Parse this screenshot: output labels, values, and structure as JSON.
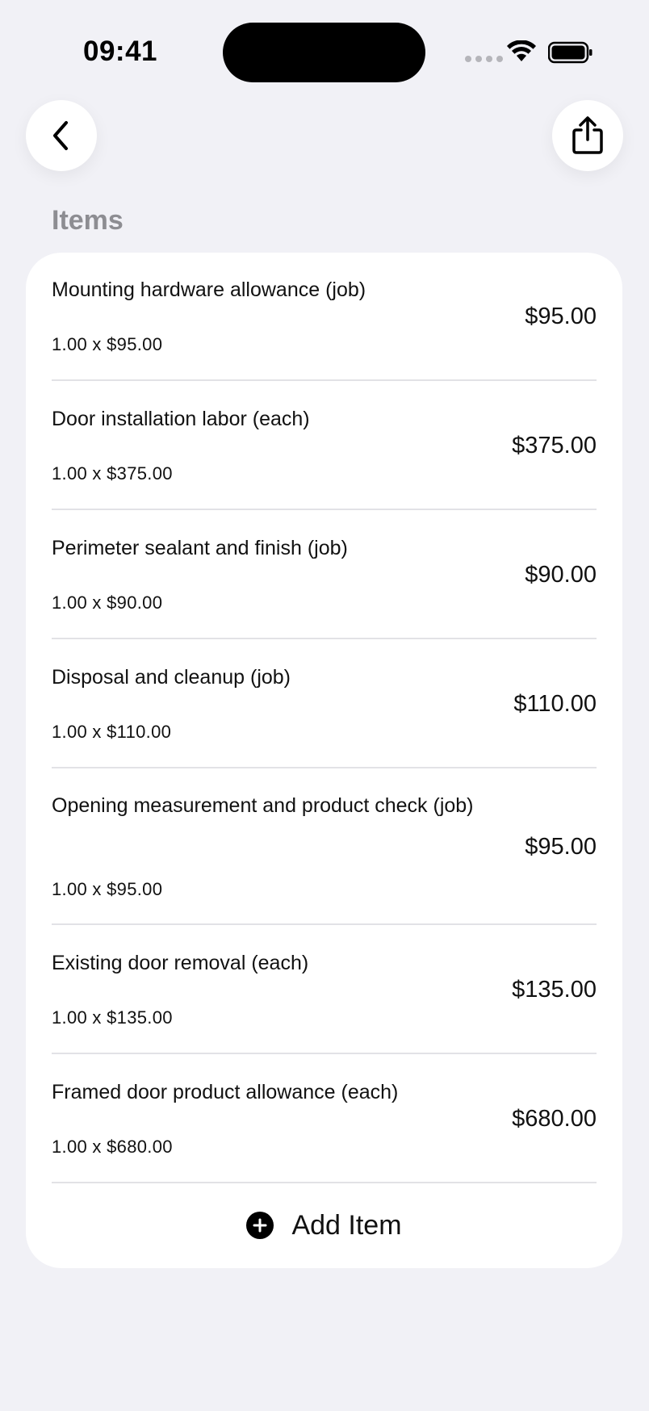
{
  "status_bar": {
    "time": "09:41"
  },
  "nav": {
    "back_icon": "chevron-left-icon",
    "share_icon": "share-icon"
  },
  "section": {
    "title": "Items"
  },
  "items": [
    {
      "name": "Mounting hardware allowance (job)",
      "qty": "1.00 x $95.00",
      "amount": "$95.00"
    },
    {
      "name": "Door installation labor (each)",
      "qty": "1.00 x $375.00",
      "amount": "$375.00"
    },
    {
      "name": "Perimeter sealant and finish (job)",
      "qty": "1.00 x $90.00",
      "amount": "$90.00"
    },
    {
      "name": "Disposal and cleanup (job)",
      "qty": "1.00 x $110.00",
      "amount": "$110.00"
    },
    {
      "name": "Opening measurement and product check (job)",
      "qty": "1.00 x $95.00",
      "amount": "$95.00"
    },
    {
      "name": "Existing door removal (each)",
      "qty": "1.00 x $135.00",
      "amount": "$135.00"
    },
    {
      "name": "Framed door product allowance (each)",
      "qty": "1.00 x $680.00",
      "amount": "$680.00"
    }
  ],
  "add_item": {
    "label": "Add Item",
    "icon": "plus-circle-icon"
  }
}
